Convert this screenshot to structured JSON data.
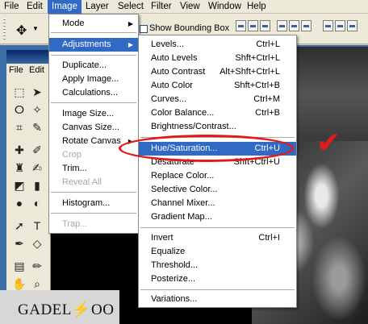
{
  "menubar": {
    "items": [
      "File",
      "Edit",
      "Image",
      "Layer",
      "Select",
      "Filter",
      "View",
      "Window",
      "Help"
    ],
    "active": "Image"
  },
  "options": {
    "checkbox_label": "Show Bounding Box"
  },
  "docmenu": {
    "file": "File",
    "edit": "Edit"
  },
  "image_menu": {
    "items": [
      {
        "label": "Mode",
        "submenu": true
      },
      {
        "label": "Adjustments",
        "submenu": true,
        "highlight": true
      },
      {
        "label": "Duplicate..."
      },
      {
        "label": "Apply Image..."
      },
      {
        "label": "Calculations..."
      },
      {
        "label": "Image Size..."
      },
      {
        "label": "Canvas Size..."
      },
      {
        "label": "Rotate Canvas",
        "submenu": true
      },
      {
        "label": "Crop",
        "disabled": true
      },
      {
        "label": "Trim..."
      },
      {
        "label": "Reveal All",
        "disabled": true
      },
      {
        "label": "Histogram..."
      },
      {
        "label": "Trap...",
        "disabled": true
      }
    ]
  },
  "adjustments_menu": {
    "items": [
      {
        "label": "Levels...",
        "shortcut": "Ctrl+L"
      },
      {
        "label": "Auto Levels",
        "shortcut": "Shft+Ctrl+L"
      },
      {
        "label": "Auto Contrast",
        "shortcut": "Alt+Shft+Ctrl+L"
      },
      {
        "label": "Auto Color",
        "shortcut": "Shft+Ctrl+B"
      },
      {
        "label": "Curves...",
        "shortcut": "Ctrl+M"
      },
      {
        "label": "Color Balance...",
        "shortcut": "Ctrl+B"
      },
      {
        "label": "Brightness/Contrast...",
        "shortcut": ""
      },
      {
        "label": "Hue/Saturation...",
        "shortcut": "Ctrl+U",
        "highlight": true
      },
      {
        "label": "Desaturate",
        "shortcut": "Shft+Ctrl+U"
      },
      {
        "label": "Replace Color...",
        "shortcut": ""
      },
      {
        "label": "Selective Color...",
        "shortcut": ""
      },
      {
        "label": "Channel Mixer...",
        "shortcut": ""
      },
      {
        "label": "Gradient Map...",
        "shortcut": ""
      },
      {
        "label": "Invert",
        "shortcut": "Ctrl+I"
      },
      {
        "label": "Equalize",
        "shortcut": ""
      },
      {
        "label": "Threshold...",
        "shortcut": ""
      },
      {
        "label": "Posterize...",
        "shortcut": ""
      },
      {
        "label": "Variations...",
        "shortcut": ""
      }
    ]
  },
  "watermark": "GADEL⚡OO",
  "colors": {
    "menu_highlight": "#316ac5",
    "annotation_red": "#e41a1a",
    "desktop_blue": "#3a6ea5"
  }
}
